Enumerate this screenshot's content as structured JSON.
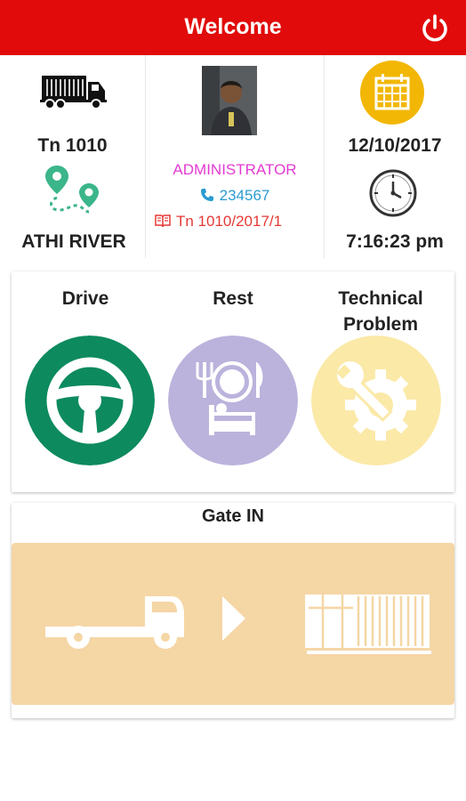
{
  "header": {
    "title": "Welcome",
    "power_icon": "power-icon"
  },
  "vehicle": {
    "number": "Tn 1010",
    "location": "ATHI RIVER"
  },
  "user": {
    "role": "ADMINISTRATOR",
    "phone": "234567",
    "trip": "Tn 1010/2017/1"
  },
  "datetime": {
    "date": "12/10/2017",
    "time": "7:16:23 pm"
  },
  "actions": [
    {
      "label": "Drive",
      "color": "#0d8a5e",
      "icon": "steering-wheel-icon"
    },
    {
      "label": "Rest",
      "color": "#bbb3dc",
      "icon": "rest-icon"
    },
    {
      "label": "Technical Problem",
      "color": "#fbe9a8",
      "icon": "wrench-gear-icon"
    }
  ],
  "gate": {
    "title": "Gate IN",
    "color": "#f5d6a5"
  },
  "colors": {
    "appbar": "#e10b0b",
    "role": "#e23ad1",
    "phone": "#2a9bd0",
    "trip": "#e53935",
    "route": "#3bb58a",
    "calendar": "#f2b705"
  }
}
